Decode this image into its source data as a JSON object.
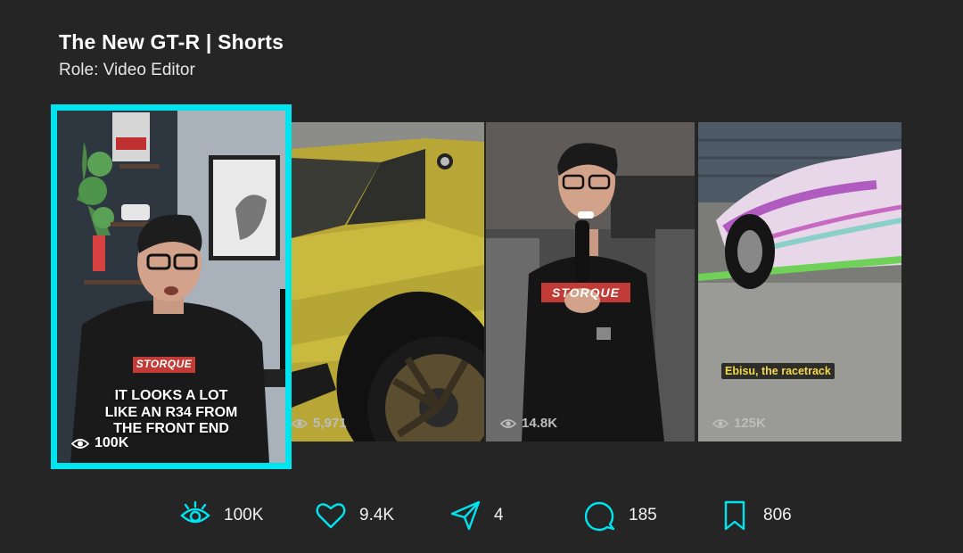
{
  "header": {
    "title": "The New GT-R | Shorts",
    "role": "Role: Video Editor"
  },
  "featured": {
    "caption_lines": [
      "IT LOOKS A LOT",
      "LIKE AN R34 FROM",
      "THE FRONT END"
    ],
    "views": "100K",
    "shirt_logo": "STORQUE"
  },
  "thumbnails": [
    {
      "views": "5,971"
    },
    {
      "views": "14.8K",
      "shirt_logo": "STORQUE"
    },
    {
      "views": "125K",
      "caption": "Ebisu, the racetrack"
    }
  ],
  "stats": {
    "views": "100K",
    "likes": "9.4K",
    "shares": "4",
    "comments": "185",
    "saves": "806"
  },
  "colors": {
    "accent": "#00e4f0",
    "background": "#252525"
  }
}
